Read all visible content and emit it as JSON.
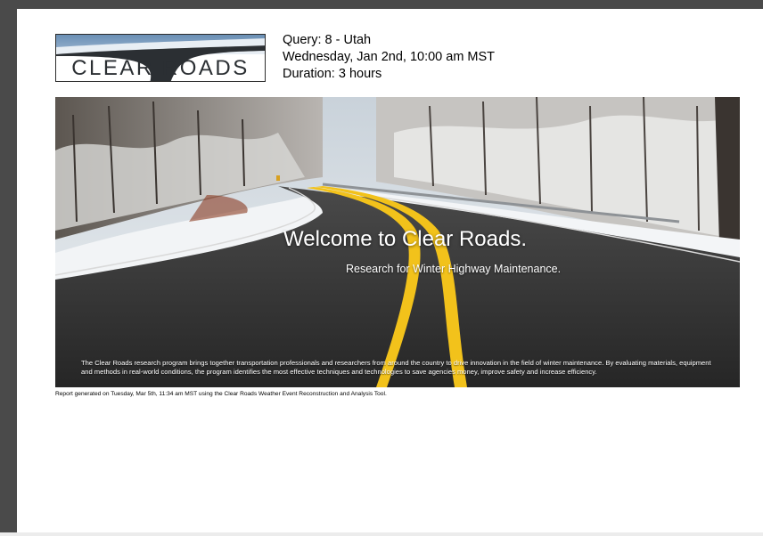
{
  "logo": {
    "text": "CLEAR ROADS"
  },
  "query": {
    "line1": "Query: 8 - Utah",
    "line2": "Wednesday, Jan 2nd, 10:00 am MST",
    "line3": "Duration: 3 hours"
  },
  "banner": {
    "title": "Welcome to Clear Roads.",
    "subtitle": "Research for Winter Highway Maintenance.",
    "description": "The Clear Roads research program brings together transportation professionals and researchers from around the country to drive innovation in the field of winter maintenance. By evaluating materials, equipment and methods in real-world conditions, the program identifies the most effective techniques and technologies to save agencies money, improve safety and increase efficiency."
  },
  "footer": {
    "note": "Report generated on Tuesday, Mar 5th, 11:34 am MST using the Clear Roads Weather Event Reconstruction and Analysis Tool."
  },
  "colors": {
    "page_background": "#ffffff",
    "viewer_background": "#4a4a4a",
    "road_line": "#f2c21b",
    "logo_sky": "#6a8fb5"
  }
}
